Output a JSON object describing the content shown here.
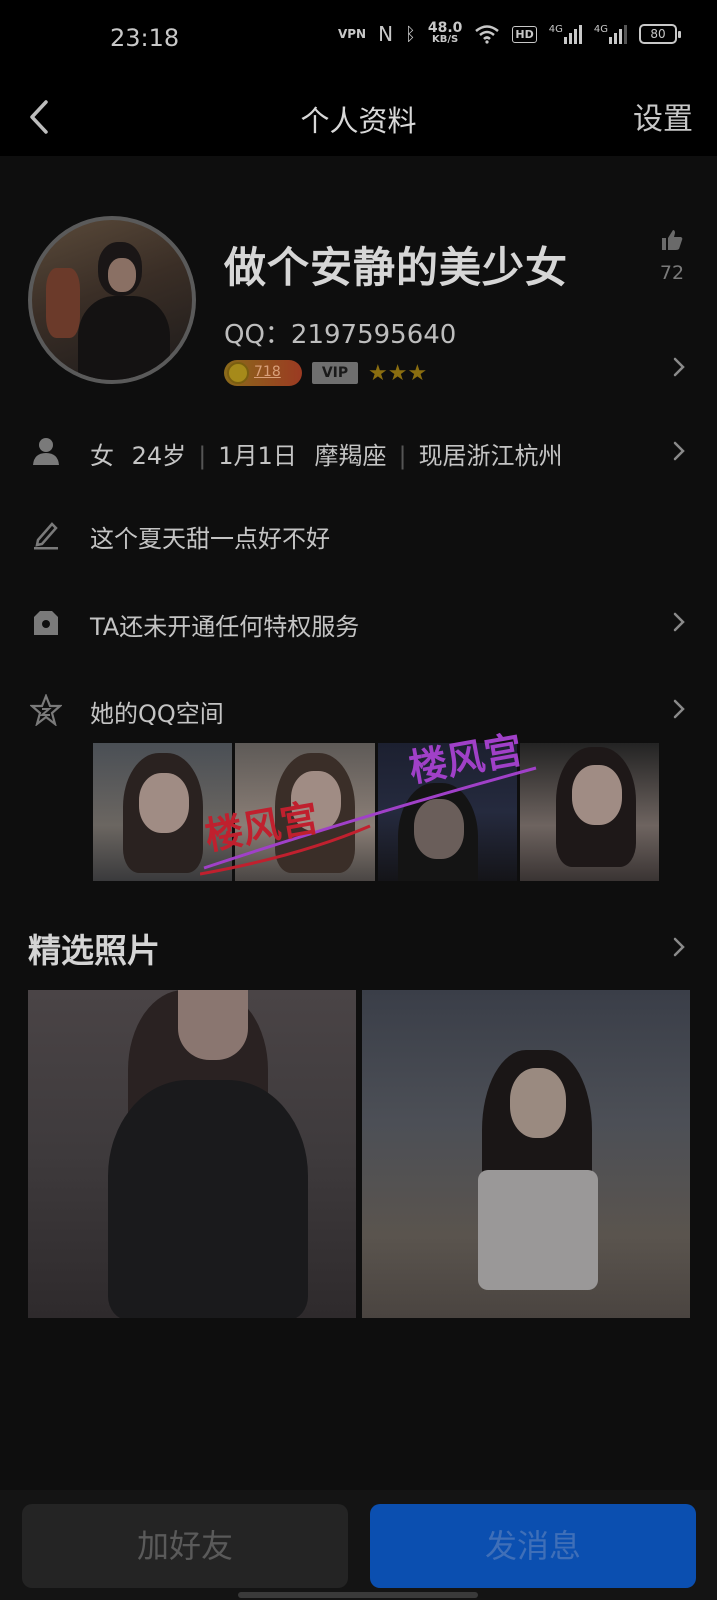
{
  "status_bar": {
    "time": "23:18",
    "vpn_label": "VPN",
    "nfc_label": "N",
    "net_speed_value": "48.0",
    "net_speed_unit": "KB/S",
    "hd_label": "HD",
    "signal1_label": "4G",
    "signal2_label": "4G",
    "battery": "80"
  },
  "nav": {
    "title": "个人资料",
    "settings_label": "设置"
  },
  "profile": {
    "nickname": "做个安静的美少女",
    "likes": "72",
    "qq_number": "QQ：2197595640",
    "level": "718",
    "vip_label": "VIP",
    "stars": "★★★"
  },
  "info": {
    "gender": "女",
    "age": "24岁",
    "birthday": "1月1日",
    "zodiac": "摩羯座",
    "location": "现居浙江杭州",
    "signature": "这个夏天甜一点好不好",
    "privilege": "TA还未开通任何特权服务",
    "qzone_label": "她的QQ空间"
  },
  "watermark": {
    "text1": "楼风宫",
    "text2": "楼风宫"
  },
  "featured": {
    "title": "精选照片"
  },
  "actions": {
    "add_friend": "加好友",
    "send_message": "发消息"
  },
  "colors": {
    "background": "#0e0e0e",
    "primary_button": "#0b4fb0",
    "secondary_button": "#242424",
    "watermark_red": "#c0202e",
    "watermark_purple": "#a040c8"
  }
}
